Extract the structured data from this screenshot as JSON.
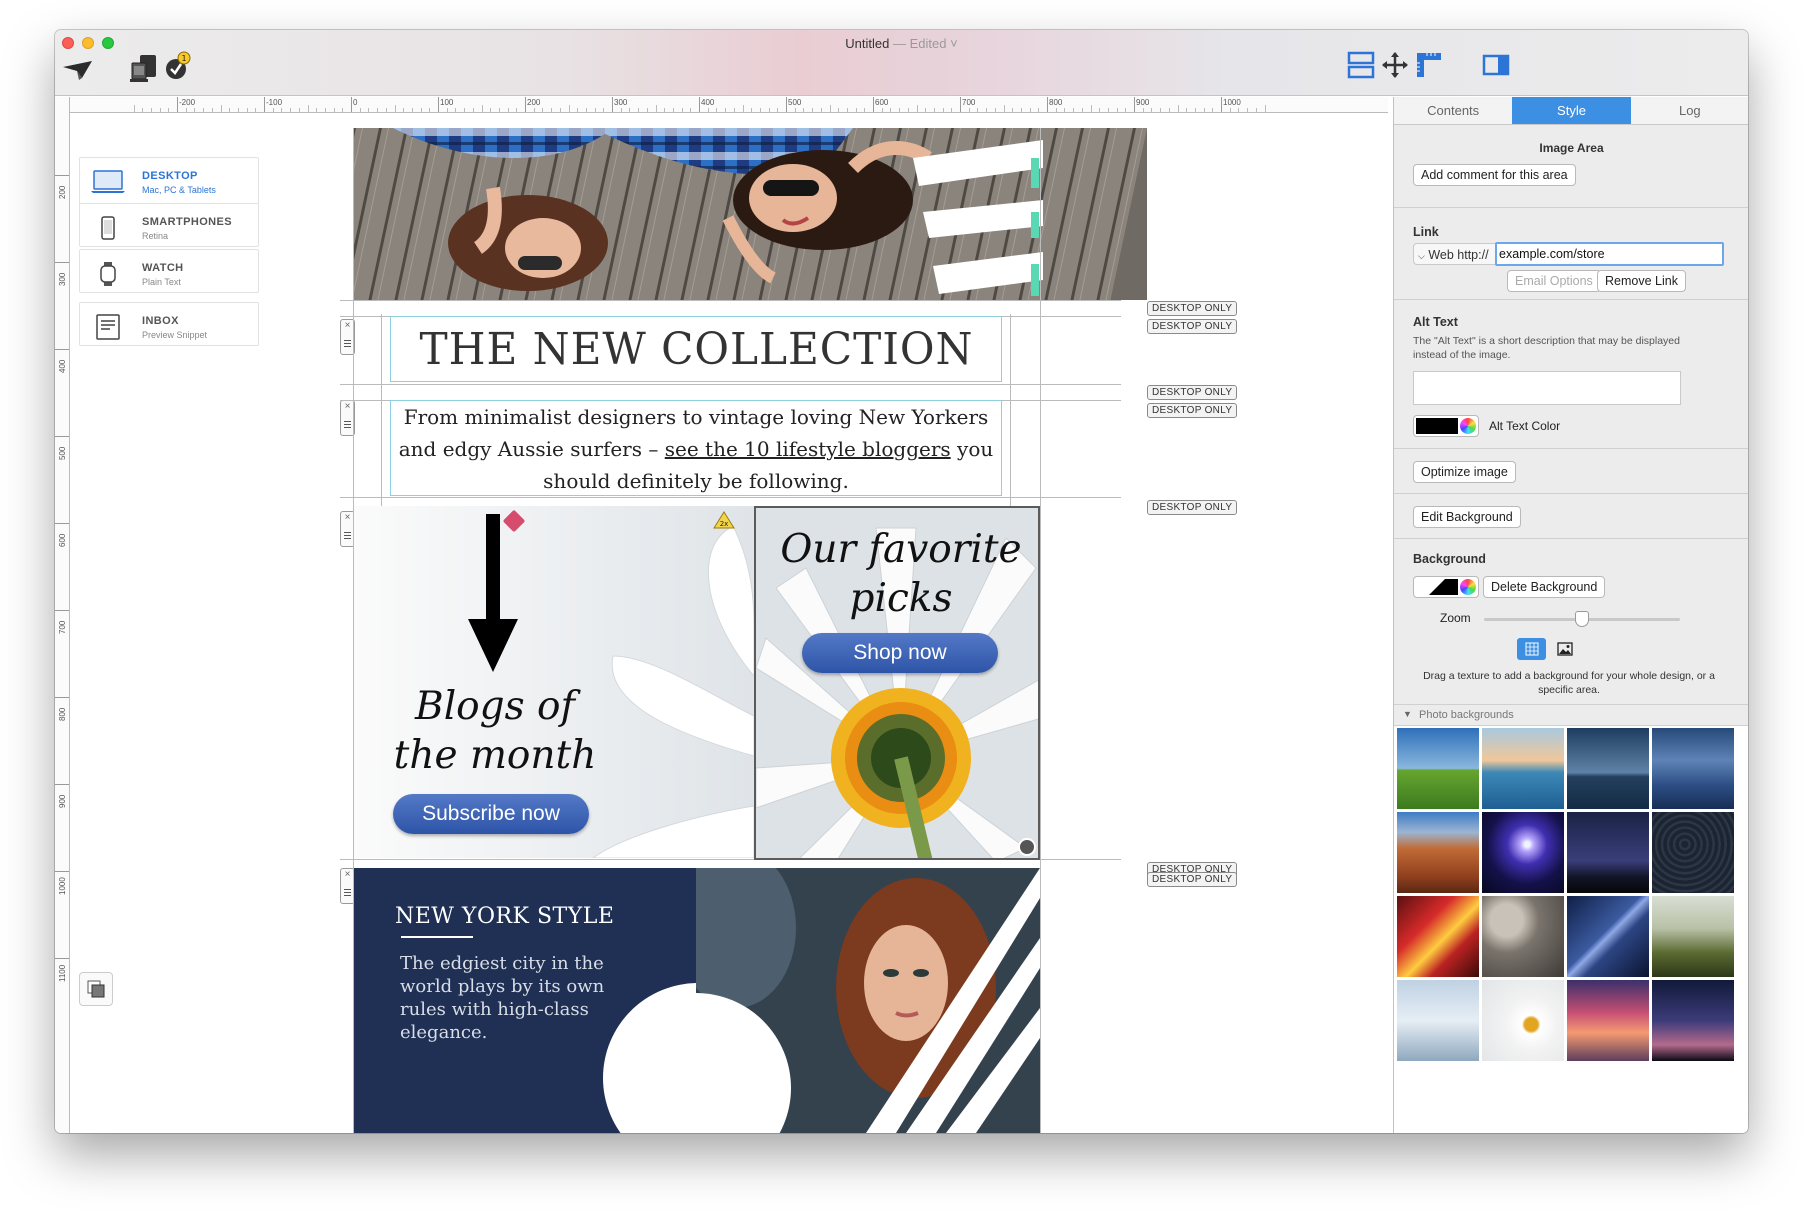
{
  "window": {
    "title": "Untitled",
    "subtitle": "— Edited ˅"
  },
  "ruler": {
    "top_labels": [
      "-200",
      "-100",
      "0",
      "100",
      "200",
      "300",
      "400",
      "500",
      "600",
      "700",
      "800",
      "900",
      "1000"
    ],
    "left_labels": [
      "200",
      "300",
      "400",
      "500",
      "600",
      "700",
      "800",
      "900",
      "1000",
      "1100"
    ]
  },
  "devices": [
    {
      "name": "DESKTOP",
      "sub": "Mac, PC & Tablets",
      "icon": "laptop-icon"
    },
    {
      "name": "SMARTPHONES",
      "sub": "Retina",
      "icon": "smartphone-icon"
    },
    {
      "name": "WATCH",
      "sub": "Plain Text",
      "icon": "watch-icon"
    },
    {
      "name": "INBOX",
      "sub": "Preview Snippet",
      "icon": "inbox-icon"
    }
  ],
  "email": {
    "badge": "DESKTOP ONLY",
    "collection_title": "THE NEW COLLECTION",
    "intro_before": "From minimalist designers to vintage loving New Yorkers and edgy Aussie surfers – ",
    "intro_link": "see the 10 lifestyle bloggers",
    "intro_after": " you should definitely be following.",
    "blogs_title": "Blogs of the month",
    "subscribe_label": "Subscribe now",
    "picks_title": "Our favorite picks",
    "shop_label": "Shop now",
    "ny_title": "NEW YORK STYLE",
    "ny_text": "The edgiest city in the world plays by its own rules with high-class elegance.",
    "retina_badge": "2x"
  },
  "panel": {
    "tabs": [
      "Contents",
      "Style",
      "Log"
    ],
    "image_area": {
      "title": "Image Area",
      "comment_button": "Add comment for this area"
    },
    "link": {
      "label": "Link",
      "type": "Web",
      "prefix": "http://",
      "value": "example.com/store",
      "email_options": "Email Options",
      "remove_link": "Remove Link"
    },
    "alt_text": {
      "label": "Alt Text",
      "description": "The \"Alt Text\" is a short description that may be displayed instead of the image.",
      "value": "",
      "color_label": "Alt Text Color"
    },
    "optimize_button": "Optimize image",
    "edit_background_button": "Edit Background",
    "background": {
      "label": "Background",
      "delete_button": "Delete Background",
      "zoom_label": "Zoom",
      "zoom_value": 0.5,
      "hint": "Drag a texture to add a background for your whole design, or a specific area."
    },
    "photo_backgrounds_label": "Photo backgrounds"
  },
  "colors": {
    "accent": "#3c8fe2",
    "navy": "#1f3054",
    "button_blue": "#3a64b8",
    "teal": "#5ad8b4"
  }
}
